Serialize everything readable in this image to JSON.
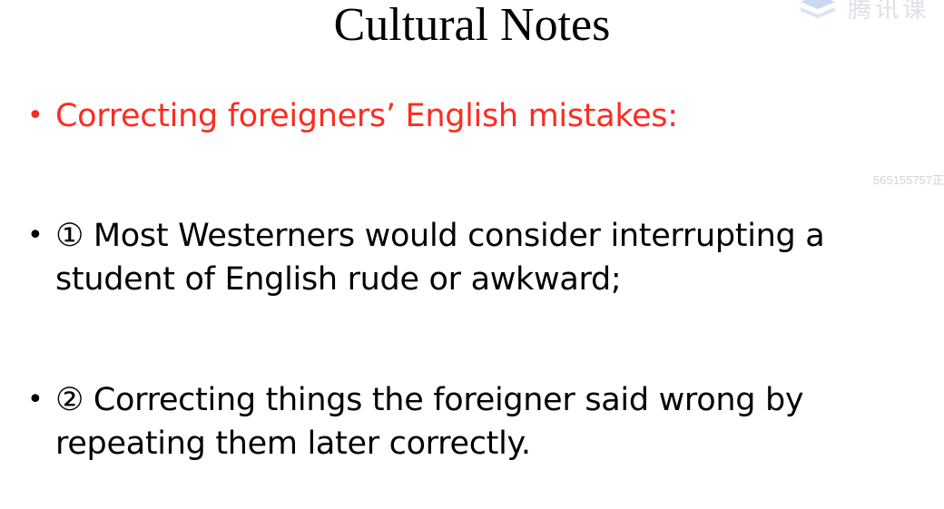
{
  "slide": {
    "title": "Cultural Notes",
    "bullets": [
      {
        "marker": "•",
        "text": "Correcting foreigners’ English mistakes:",
        "color": "#ff2b1f"
      },
      {
        "marker": "•",
        "text": "① Most Westerners would consider interrupting a student of English rude or awkward;"
      },
      {
        "marker": "•",
        "text": "② Correcting things the foreigner said wrong by repeating them later correctly."
      }
    ]
  },
  "watermark": {
    "logo_text": "腾讯课",
    "id_text": "565155757正",
    "icon": "stack-logo-icon"
  }
}
